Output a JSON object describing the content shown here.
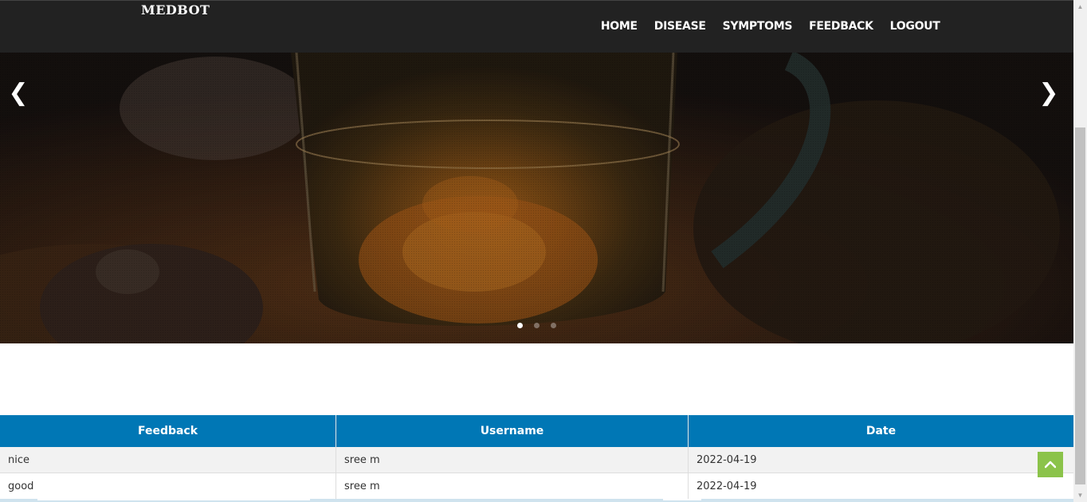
{
  "navbar": {
    "brand": "MEDBOT",
    "items": [
      {
        "label": "HOME"
      },
      {
        "label": "DISEASE"
      },
      {
        "label": "SYMPTOMS"
      },
      {
        "label": "FEEDBACK"
      },
      {
        "label": "LOGOUT"
      }
    ]
  },
  "carousel": {
    "prev_icon": "chevron-left-icon",
    "next_icon": "chevron-right-icon",
    "prev_glyph": "❮",
    "next_glyph": "❯",
    "slide_count": 3,
    "active_slide": 1
  },
  "table": {
    "headers": [
      "Feedback",
      "Username",
      "Date"
    ],
    "rows": [
      {
        "feedback": "nice",
        "username": "sree m",
        "date": "2022-04-19"
      },
      {
        "feedback": "good",
        "username": "sree m",
        "date": "2022-04-19"
      }
    ],
    "header_color": "#0077b5"
  },
  "back_to_top": {
    "icon": "chevron-up-icon",
    "color": "#8bc34a"
  }
}
